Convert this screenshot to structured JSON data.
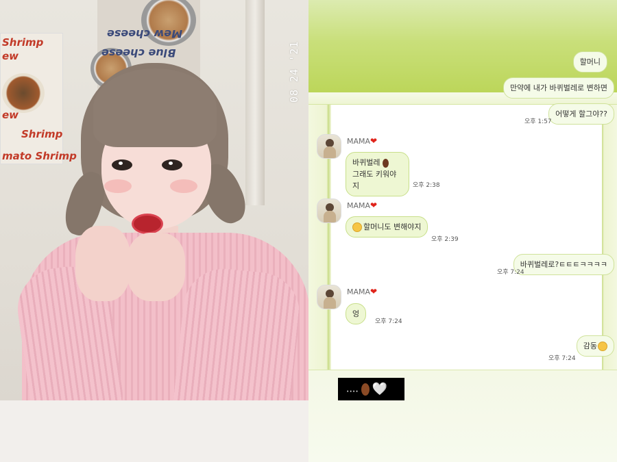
{
  "photo": {
    "poster_left_lines": [
      "Shrimp",
      "ew",
      "Shrimp",
      "ew",
      "mato Shrimp"
    ],
    "poster_top_lines": [
      "Blue cheese",
      "Mew cheese"
    ],
    "date_stamp": "08 24 '21"
  },
  "chat": {
    "outgoing_group_1": {
      "messages": [
        "할머니",
        "만약에 내가 바퀴벌레로 변하면",
        "어떻게 할그야??"
      ],
      "time": "오후 1:57"
    },
    "incoming_1": {
      "sender": "MAMA",
      "lines": [
        "바퀴벌레",
        "그래도 키워야지"
      ],
      "emoji": "cockroach-icon",
      "time": "오후 2:38"
    },
    "incoming_2": {
      "sender": "MAMA",
      "text": "할머니도 변해야지",
      "emoji": "baby-face-icon",
      "time": "오후 2:39"
    },
    "outgoing_2": {
      "text": "바퀴벌레로?ㅌㅌㅌㅋㅋㅋㅋ",
      "time": "오후 7:24"
    },
    "incoming_3": {
      "sender": "MAMA",
      "text": "엉",
      "time": "오후 7:24"
    },
    "outgoing_3": {
      "text": "감동",
      "emoji": "touched-face-icon",
      "time": "오후 7:24"
    },
    "heart_symbol": "❤",
    "caption": {
      "text": "....",
      "emoji": [
        "cockroach-icon",
        "white-heart-icon"
      ],
      "white_heart": "🤍"
    }
  },
  "colors": {
    "chat_green": "#c9df7a",
    "bubble_bg": "#f5fbe8",
    "heart_red": "#e0241b"
  }
}
